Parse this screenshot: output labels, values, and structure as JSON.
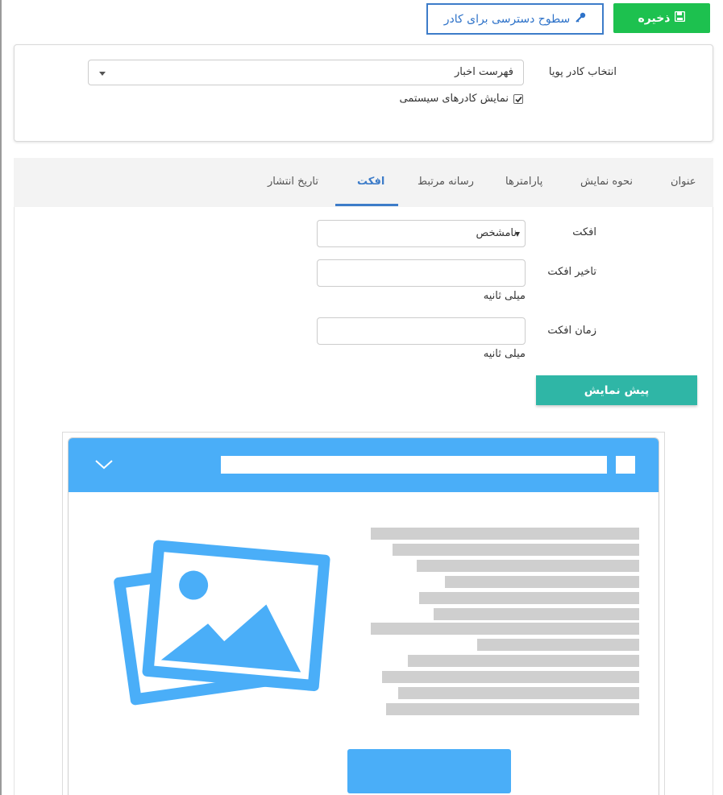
{
  "toolbar": {
    "save_label": "ذخیره",
    "access_label": "سطوح دسترسی برای کادر"
  },
  "frame_panel": {
    "select_label": "انتخاب کادر پویا",
    "selected_frame": "فهرست اخبار",
    "show_system_label": "نمایش کادرهای سیستمی",
    "show_system_checked": true
  },
  "tabs": [
    {
      "label": "عنوان",
      "active": false
    },
    {
      "label": "نحوه نمایش",
      "active": false
    },
    {
      "label": "پارامترها",
      "active": false
    },
    {
      "label": "رسانه مرتبط",
      "active": false
    },
    {
      "label": "افکت",
      "active": true
    },
    {
      "label": "تاریخ انتشار",
      "active": false
    }
  ],
  "effect_form": {
    "effect_label": "افکت",
    "effect_value": "نامشخص",
    "delay_label": "تاخیر افکت",
    "delay_value": "",
    "delay_unit": "میلی ثانیه",
    "duration_label": "زمان افکت",
    "duration_value": "",
    "duration_unit": "میلی ثانیه",
    "preview_label": "پیش نمایش"
  },
  "colors": {
    "save_green": "#1dc14f",
    "access_blue": "#3d7cc9",
    "preview_teal": "#2fb6a6",
    "illustration_blue": "#4aaef8",
    "placeholder_gray": "#cfcfcf"
  },
  "icons": {
    "save": "floppy-disk-icon",
    "access": "key-icon",
    "dropdown": "caret-down-icon",
    "collapse": "chevron-down-icon",
    "picture": "image-placeholder-icon"
  }
}
